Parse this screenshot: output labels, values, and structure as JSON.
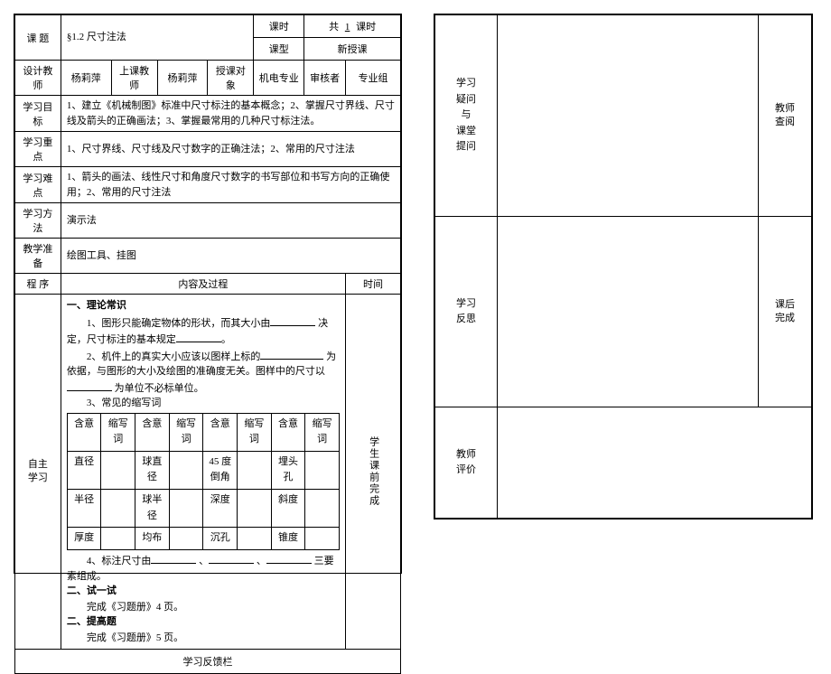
{
  "header": {
    "topic_label": "课   题",
    "topic_value": "§1.2 尺寸注法",
    "keshi_label": "课时",
    "keshi_value_prefix": "共",
    "keshi_value_num": "1",
    "keshi_value_suffix": "课时",
    "kexing_label": "课型",
    "kexing_value": "新授课",
    "designer_label": "设计教师",
    "designer_value": "杨莉萍",
    "teacher_label": "上课教师",
    "teacher_value": "杨莉萍",
    "audience_label": "授课对象",
    "audience_value": "机电专业",
    "reviewer_label": "审核者",
    "reviewer_value": "专业组"
  },
  "rows": {
    "goal_label": "学习目标",
    "goal_value": "1、建立《机械制图》标准中尺寸标注的基本概念；2、掌握尺寸界线、尺寸线及箭头的正确画法；3、掌握最常用的几种尺寸标注法。",
    "focus_label": "学习重点",
    "focus_value": "1、尺寸界线、尺寸线及尺寸数字的正确注法；2、常用的尺寸注法",
    "diff_label": "学习难点",
    "diff_value": "1、箭头的画法、线性尺寸和角度尺寸数字的书写部位和书写方向的正确使用；2、常用的尺寸注法",
    "method_label": "学习方法",
    "method_value": "演示法",
    "prep_label": "教学准备",
    "prep_value": "绘图工具、挂图"
  },
  "proc": {
    "chengxu_label": "程  序",
    "neirong_label": "内容及过程",
    "shijian_label": "时间",
    "zizhu_label": "自主\n学习",
    "shijian_value": "学生课前完成"
  },
  "content": {
    "h1": "一、理论常识",
    "p1a": "1、图形只能确定物体的形状，而其大小由",
    "p1b": "决定，尺寸标注的基本规定",
    "p1c": "。",
    "p2a": "2、机件上的真实大小应该以图样上标的",
    "p2b": "为依据，与图形的大小及绘图的准确度无关。图样中的尺寸以",
    "p2c": "为单位不必标单位。",
    "p3": "3、常见的缩写词",
    "table": {
      "h_meaning": "含意",
      "h_abbr": "缩写词",
      "r1c1": "直径",
      "r1c3": "球直径",
      "r1c5": "45 度倒角",
      "r1c7": "埋头孔",
      "r2c1": "半径",
      "r2c3": "球半径",
      "r2c5": "深度",
      "r2c7": "斜度",
      "r3c1": "厚度",
      "r3c3": "均布",
      "r3c5": "沉孔",
      "r3c7": "锥度"
    },
    "p4a": "4、标注尺寸由",
    "p4b": "、",
    "p4c": "、",
    "p4d": "三要素组成。",
    "h2": "二、试一试",
    "p5": "完成《习题册》4 页。",
    "h3": "二、提高题",
    "p6": "完成《习题册》5 页。"
  },
  "footer": {
    "feedback_label": "学习反馈栏"
  },
  "right": {
    "r1_label": "学习\n疑问\n与\n课堂\n提问",
    "r1_side": "教师\n查阅",
    "r2_label": "学习\n反思",
    "r2_side": "课后\n完成",
    "r3_label": "教师\n评价"
  }
}
